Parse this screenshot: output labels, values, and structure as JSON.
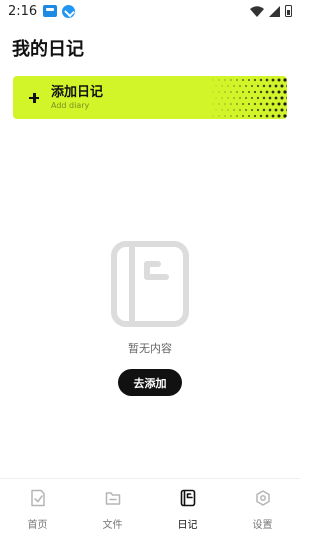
{
  "status_bar": {
    "time": "2:16"
  },
  "page_title": "我的日记",
  "add_card": {
    "label": "添加日记",
    "sublabel": "Add diary",
    "accent_color": "#d2f52a"
  },
  "empty_state": {
    "text": "暂无内容",
    "button_label": "去添加"
  },
  "bottom_nav": {
    "items": [
      {
        "label": "首页",
        "icon": "home-diary-icon",
        "active": false
      },
      {
        "label": "文件",
        "icon": "folder-icon",
        "active": false
      },
      {
        "label": "日记",
        "icon": "diary-icon",
        "active": true
      },
      {
        "label": "设置",
        "icon": "settings-icon",
        "active": false
      }
    ]
  }
}
